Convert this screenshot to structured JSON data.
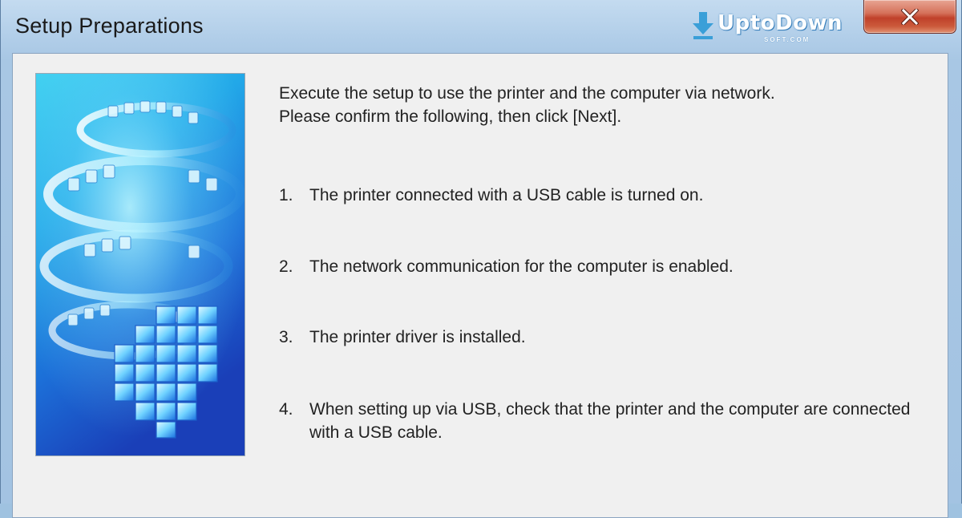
{
  "window": {
    "title": "Setup Preparations",
    "close_label": "Close"
  },
  "watermark": {
    "word": "UptoDown",
    "sub": "SOFT.COM"
  },
  "intro": {
    "line1": "Execute the setup to use the printer and the computer via network.",
    "line2": "Please confirm the following, then click [Next]."
  },
  "checklist": [
    {
      "num": "1.",
      "text": "The printer connected with a USB cable is turned on."
    },
    {
      "num": "2.",
      "text": "The network communication for the computer is enabled."
    },
    {
      "num": "3.",
      "text": "The printer driver is installed."
    },
    {
      "num": "4.",
      "text": "When setting up via USB, check that the printer and the computer are connected with a USB cable."
    }
  ],
  "colors": {
    "title_bar": "#a8c7e4",
    "client_bg": "#f0f0f0",
    "close_button": "#c0412a",
    "art_blue": "#1f6fd0"
  },
  "icons": {
    "close": "close-icon",
    "watermark": "download-arrow-icon"
  }
}
